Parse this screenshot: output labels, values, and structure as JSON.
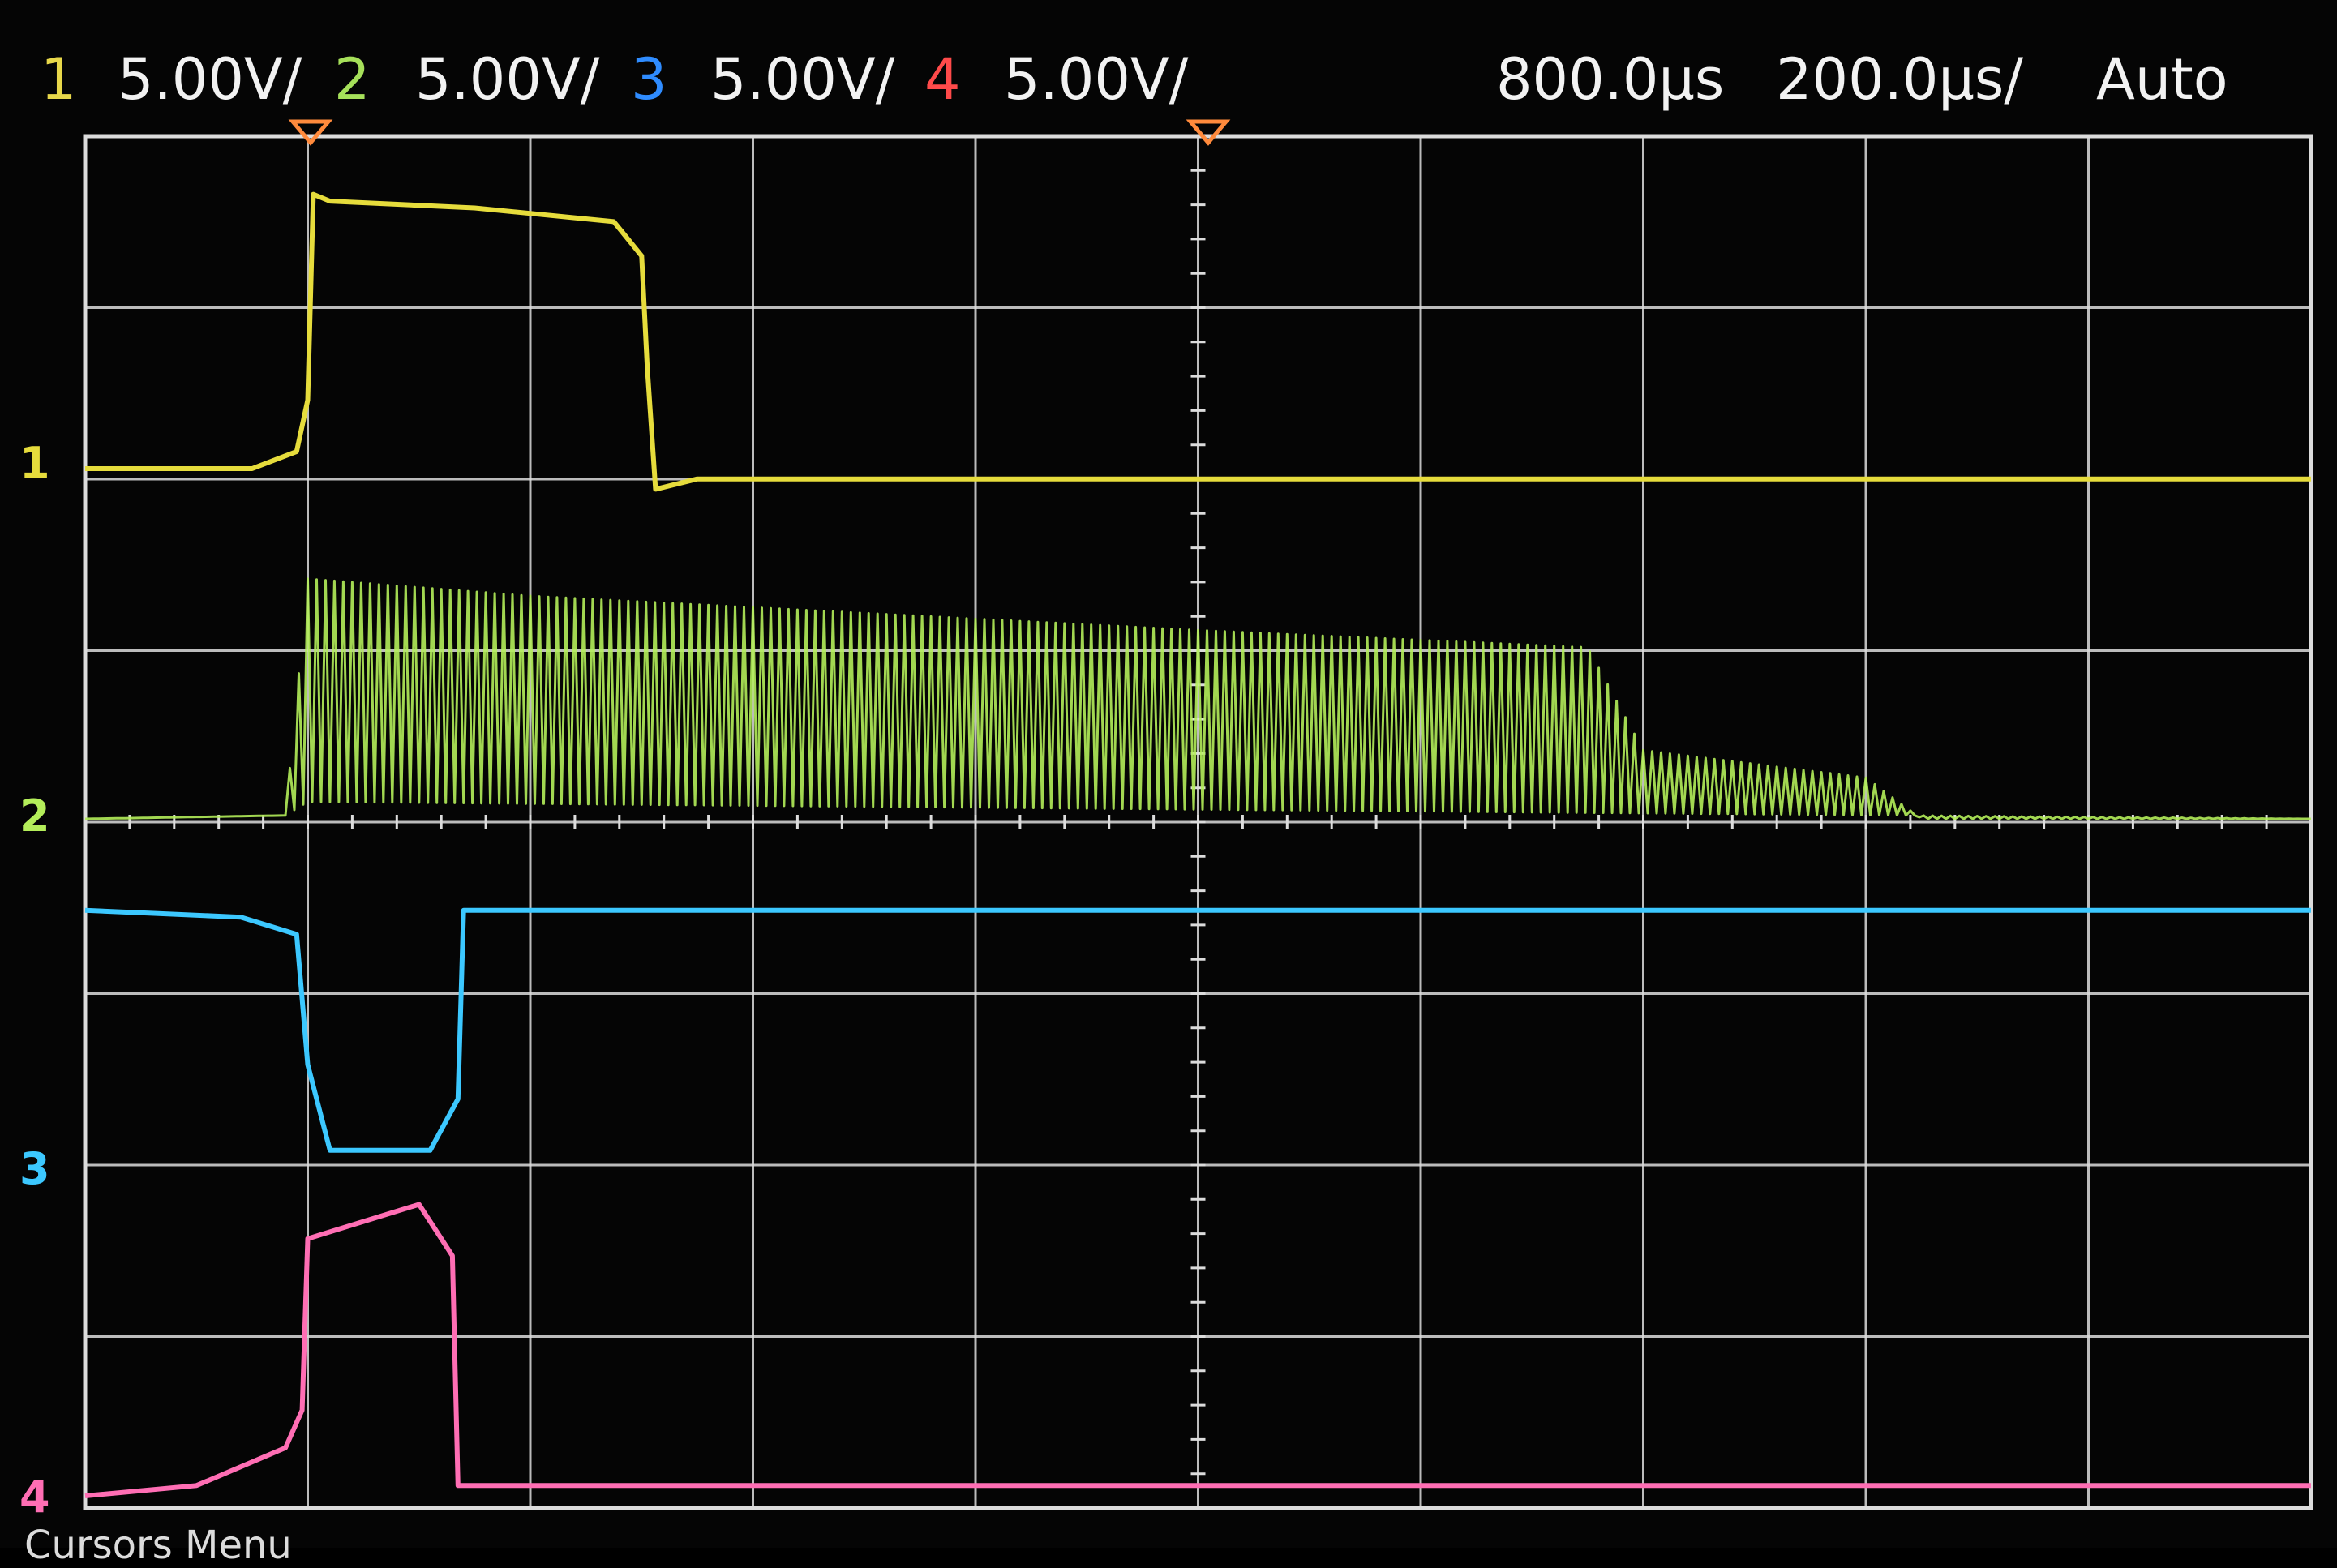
{
  "header": {
    "channels": [
      {
        "num": "1",
        "scale": "5.00V/",
        "color": "#e8d84a"
      },
      {
        "num": "2",
        "scale": "5.00V/",
        "color": "#a6e05a"
      },
      {
        "num": "3",
        "scale": "5.00V/",
        "color": "#2f8cff"
      },
      {
        "num": "4",
        "scale": "5.00V/",
        "color": "#ff4a4a"
      }
    ],
    "time_delay": "800.0µs",
    "time_scale": "200.0µs/",
    "trigger_mode": "Auto"
  },
  "ground_markers": [
    "1",
    "2",
    "3",
    "4"
  ],
  "bottom_menu": "Cursors Menu",
  "colors": {
    "grid": "#dcdcdc",
    "ch1_trace": "#e6dc3c",
    "ch2_trace": "#b4ee5a",
    "ch3_trace": "#3cc8ff",
    "ch4_trace": "#ff6eb4",
    "trigger_marker": "#ff8a3c"
  },
  "chart_data": {
    "type": "line",
    "title": "",
    "xlabel": "",
    "ylabel": "",
    "x_unit": "µs",
    "y_unit": "V",
    "xlim": [
      -1000,
      3000
    ],
    "series": [
      {
        "channel": "1",
        "color": "#e6dc3c",
        "points": [
          [
            -1000,
            0
          ],
          [
            -700,
            0
          ],
          [
            -620,
            0.5
          ],
          [
            -600,
            2
          ],
          [
            -590,
            8
          ],
          [
            -560,
            7.8
          ],
          [
            -300,
            7.6
          ],
          [
            -50,
            7.2
          ],
          [
            0,
            6.2
          ],
          [
            10,
            3
          ],
          [
            25,
            -0.6
          ],
          [
            100,
            -0.3
          ],
          [
            3000,
            -0.3
          ]
        ]
      },
      {
        "channel": "2",
        "color": "#b4ee5a",
        "oscillating": true,
        "envelope_low": [
          [
            -1000,
            0
          ],
          [
            -640,
            0.1
          ],
          [
            -600,
            0.5
          ],
          [
            3000,
            0
          ]
        ],
        "envelope_high": [
          [
            -1000,
            0
          ],
          [
            -640,
            0.1
          ],
          [
            -600,
            7
          ],
          [
            -200,
            6.5
          ],
          [
            1000,
            5.5
          ],
          [
            1700,
            5.0
          ],
          [
            1800,
            2.0
          ],
          [
            2200,
            1.2
          ],
          [
            2300,
            0
          ],
          [
            3000,
            0
          ]
        ]
      },
      {
        "channel": "3",
        "color": "#3cc8ff",
        "points": [
          [
            -1000,
            7.5
          ],
          [
            -720,
            7.3
          ],
          [
            -620,
            6.8
          ],
          [
            -600,
            3
          ],
          [
            -560,
            0.5
          ],
          [
            -380,
            0.5
          ],
          [
            -330,
            2
          ],
          [
            -320,
            7.5
          ],
          [
            3000,
            7.5
          ]
        ]
      },
      {
        "channel": "4",
        "color": "#ff6eb4",
        "points": [
          [
            -1000,
            0
          ],
          [
            -800,
            0.3
          ],
          [
            -640,
            1.4
          ],
          [
            -610,
            2.5
          ],
          [
            -600,
            7.5
          ],
          [
            -500,
            8
          ],
          [
            -400,
            8.5
          ],
          [
            -340,
            7
          ],
          [
            -330,
            0.3
          ],
          [
            3000,
            0.3
          ]
        ]
      }
    ]
  }
}
